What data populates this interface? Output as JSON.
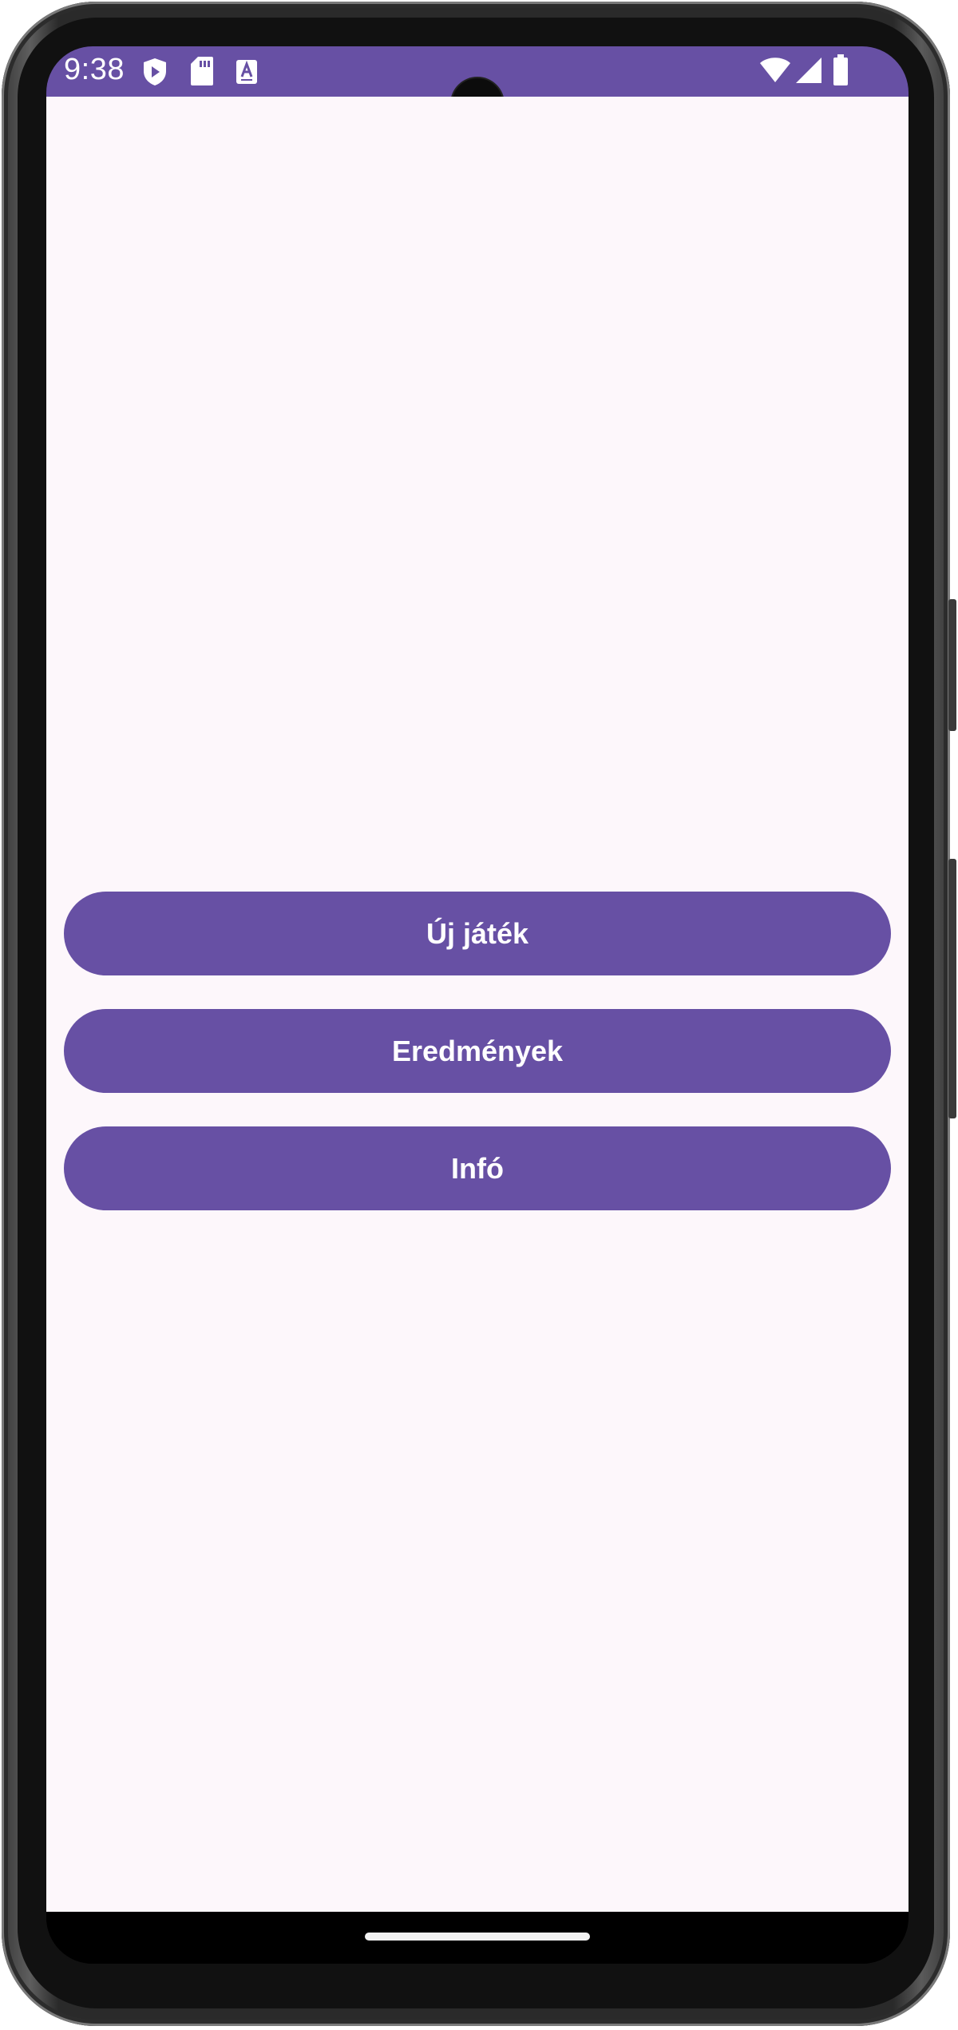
{
  "status_bar": {
    "time": "9:38",
    "left_icons": [
      "play-protect-icon",
      "sd-card-icon",
      "keyboard-a-icon"
    ],
    "right_icons": [
      "wifi-icon",
      "cellular-signal-icon",
      "battery-icon"
    ]
  },
  "menu": {
    "buttons": [
      {
        "label": "Új játék"
      },
      {
        "label": "Eredmények"
      },
      {
        "label": "Infó"
      }
    ]
  },
  "colors": {
    "primary": "#6750a4",
    "background": "#fdf7fb",
    "on_primary": "#ffffff"
  }
}
